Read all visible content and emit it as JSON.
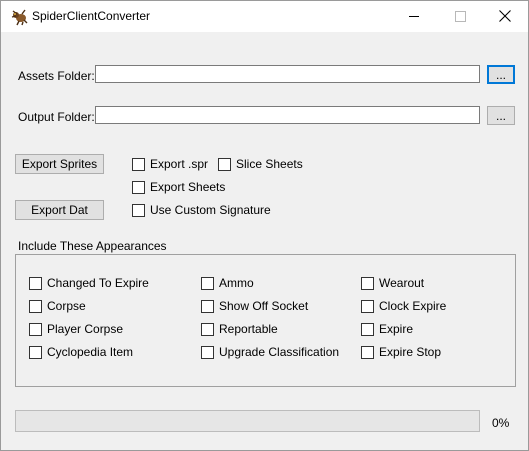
{
  "window": {
    "title": "SpiderClientConverter"
  },
  "assets": {
    "label": "Assets Folder:",
    "value": "",
    "browse_label": "..."
  },
  "output": {
    "label": "Output Folder:",
    "value": "",
    "browse_label": "..."
  },
  "actions": {
    "export_sprites": "Export Sprites",
    "export_dat": "Export Dat"
  },
  "options": {
    "export_spr": {
      "label": "Export .spr",
      "checked": false
    },
    "slice_sheets": {
      "label": "Slice Sheets",
      "checked": false
    },
    "export_sheets": {
      "label": "Export Sheets",
      "checked": false
    },
    "use_custom_signature": {
      "label": "Use Custom Signature",
      "checked": false
    }
  },
  "appearances": {
    "group_label": "Include These Appearances",
    "items": [
      {
        "label": "Changed To Expire",
        "checked": false
      },
      {
        "label": "Corpse",
        "checked": false
      },
      {
        "label": "Player Corpse",
        "checked": false
      },
      {
        "label": "Cyclopedia Item",
        "checked": false
      },
      {
        "label": "Ammo",
        "checked": false
      },
      {
        "label": "Show Off Socket",
        "checked": false
      },
      {
        "label": "Reportable",
        "checked": false
      },
      {
        "label": "Upgrade Classification",
        "checked": false
      },
      {
        "label": "Wearout",
        "checked": false
      },
      {
        "label": "Clock Expire",
        "checked": false
      },
      {
        "label": "Expire",
        "checked": false
      },
      {
        "label": "Expire Stop",
        "checked": false
      }
    ]
  },
  "progress": {
    "value": 0,
    "text": "0%"
  }
}
